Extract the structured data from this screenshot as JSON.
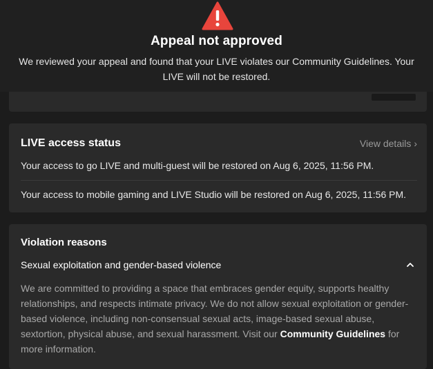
{
  "dialog": {
    "title": "Appeal not approved",
    "message_line1": "We reviewed your appeal and found that your LIVE violates our Community Guidelines. Your",
    "message_line2": "LIVE will not be restored.",
    "icon": "warning-triangle-icon",
    "icon_color": "#e8453c"
  },
  "access_status": {
    "title": "LIVE access status",
    "view_details": "View details",
    "lines": [
      "Your access to go LIVE and multi-guest will be restored on Aug 6, 2025, 11:56 PM.",
      "Your access to mobile gaming and LIVE Studio will be restored on Aug 6, 2025, 11:56 PM."
    ]
  },
  "violation": {
    "title": "Violation reasons",
    "reason": "Sexual exploitation and gender-based violence",
    "description": "We are committed to providing a space that embraces gender equity, supports healthy relationships, and respects intimate privacy. We do not allow sexual exploitation or gender-based violence, including non-consensual sexual acts, image-based sexual abuse, sextortion, physical abuse, and sexual harassment. Visit our",
    "link_text": "Community Guidelines",
    "description_tail": "for more information."
  }
}
